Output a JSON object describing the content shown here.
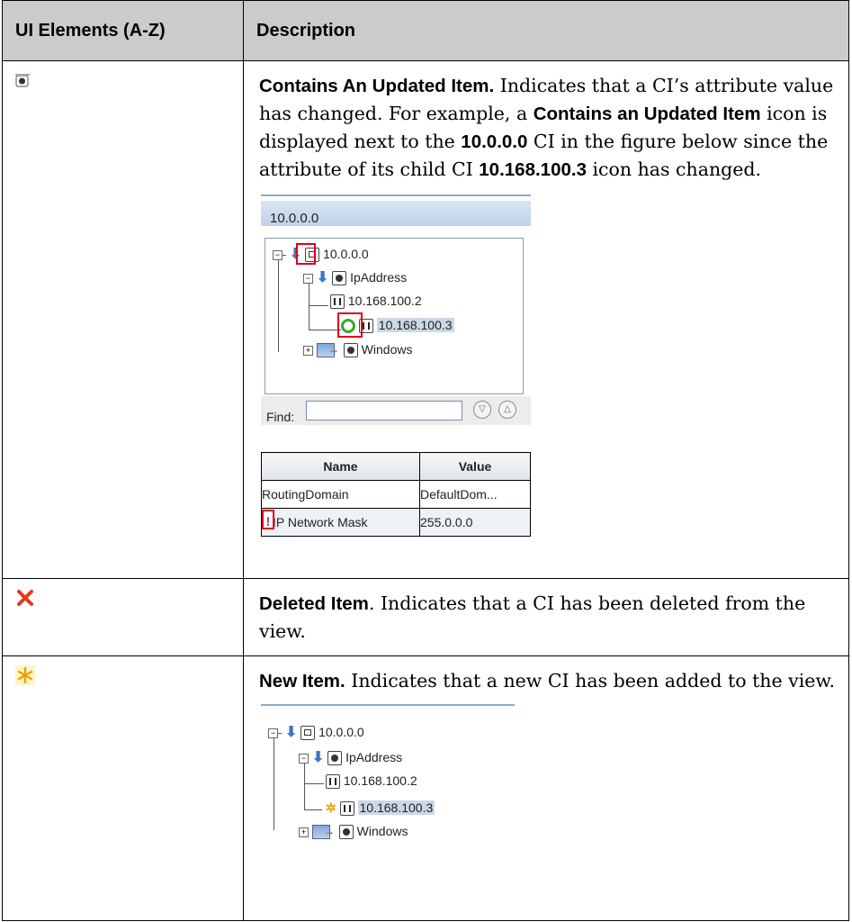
{
  "header": {
    "col1": "UI Elements (A-Z)",
    "col2": "Description"
  },
  "rows": [
    {
      "icon": "contains-updated-item-icon",
      "title": "Contains An Updated Item.",
      "t1": " Indicates that a CI’s attribute value has changed. For example, a ",
      "b1": "Contains an Updated Item",
      "t2": " icon is displayed next to the ",
      "b2": "10.0.0.0",
      "t3": " CI in the figure below since the attribute of its child CI ",
      "b3": "10.168.100.3",
      "t4": " icon has changed."
    },
    {
      "icon": "deleted-item-icon",
      "title": "Deleted Item",
      "text": ". Indicates that a CI has been deleted from the view."
    },
    {
      "icon": "new-item-icon",
      "title": "New Item.",
      "text": " Indicates that a new CI has been added to the view."
    }
  ],
  "screenshot1": {
    "title": "10.0.0.0",
    "tree": {
      "root": "10.0.0.0",
      "ipaddress": "IpAddress",
      "child1": "10.168.100.2",
      "child2": "10.168.100.3",
      "windows": "Windows"
    },
    "find_label": "Find:",
    "grid": {
      "headers": [
        "Name",
        "Value"
      ],
      "rows": [
        [
          "RoutingDomain",
          "DefaultDom..."
        ],
        [
          "IP Network Mask",
          "255.0.0.0"
        ]
      ]
    }
  },
  "screenshot2": {
    "tree": {
      "root": "10.0.0.0",
      "ipaddress": "IpAddress",
      "child1": "10.168.100.2",
      "child2": "10.168.100.3",
      "windows": "Windows"
    }
  }
}
